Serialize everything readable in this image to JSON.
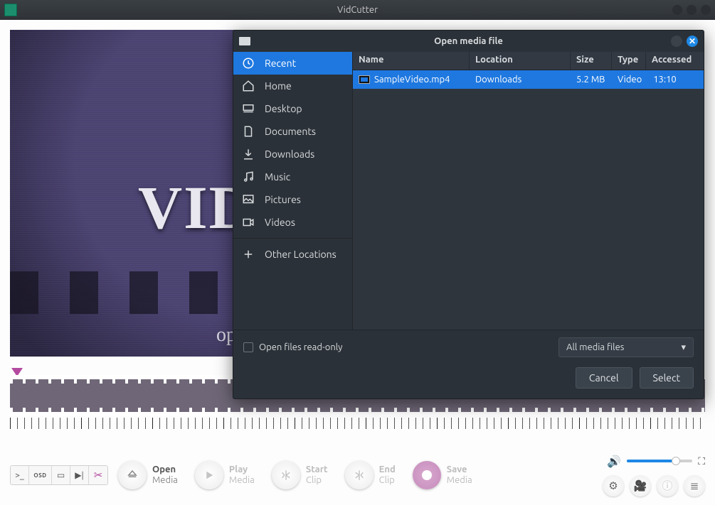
{
  "app": {
    "title": "VidCutter"
  },
  "preview": {
    "logo_text": "VID",
    "hint": "op"
  },
  "dialog": {
    "title": "Open media file",
    "places": [
      {
        "key": "recent",
        "label": "Recent",
        "active": true
      },
      {
        "key": "home",
        "label": "Home",
        "active": false
      },
      {
        "key": "desktop",
        "label": "Desktop",
        "active": false
      },
      {
        "key": "documents",
        "label": "Documents",
        "active": false
      },
      {
        "key": "downloads",
        "label": "Downloads",
        "active": false
      },
      {
        "key": "music",
        "label": "Music",
        "active": false
      },
      {
        "key": "pictures",
        "label": "Pictures",
        "active": false
      },
      {
        "key": "videos",
        "label": "Videos",
        "active": false
      },
      {
        "key": "other",
        "label": "Other Locations",
        "active": false
      }
    ],
    "columns": {
      "name": "Name",
      "location": "Location",
      "size": "Size",
      "type": "Type",
      "accessed": "Accessed"
    },
    "rows": [
      {
        "name": "SampleVideo.mp4",
        "location": "Downloads",
        "size": "5.2 MB",
        "type": "Video",
        "accessed": "13:10"
      }
    ],
    "readonly_label": "Open files read-only",
    "filter": "All media files",
    "cancel": "Cancel",
    "select": "Select"
  },
  "toolbar": {
    "osd": "OSD",
    "actions": {
      "open": {
        "l1": "Open",
        "l2": "Media"
      },
      "play": {
        "l1": "Play",
        "l2": "Media"
      },
      "start": {
        "l1": "Start",
        "l2": "Clip"
      },
      "end": {
        "l1": "End",
        "l2": "Clip"
      },
      "save": {
        "l1": "Save",
        "l2": "Media"
      }
    }
  }
}
